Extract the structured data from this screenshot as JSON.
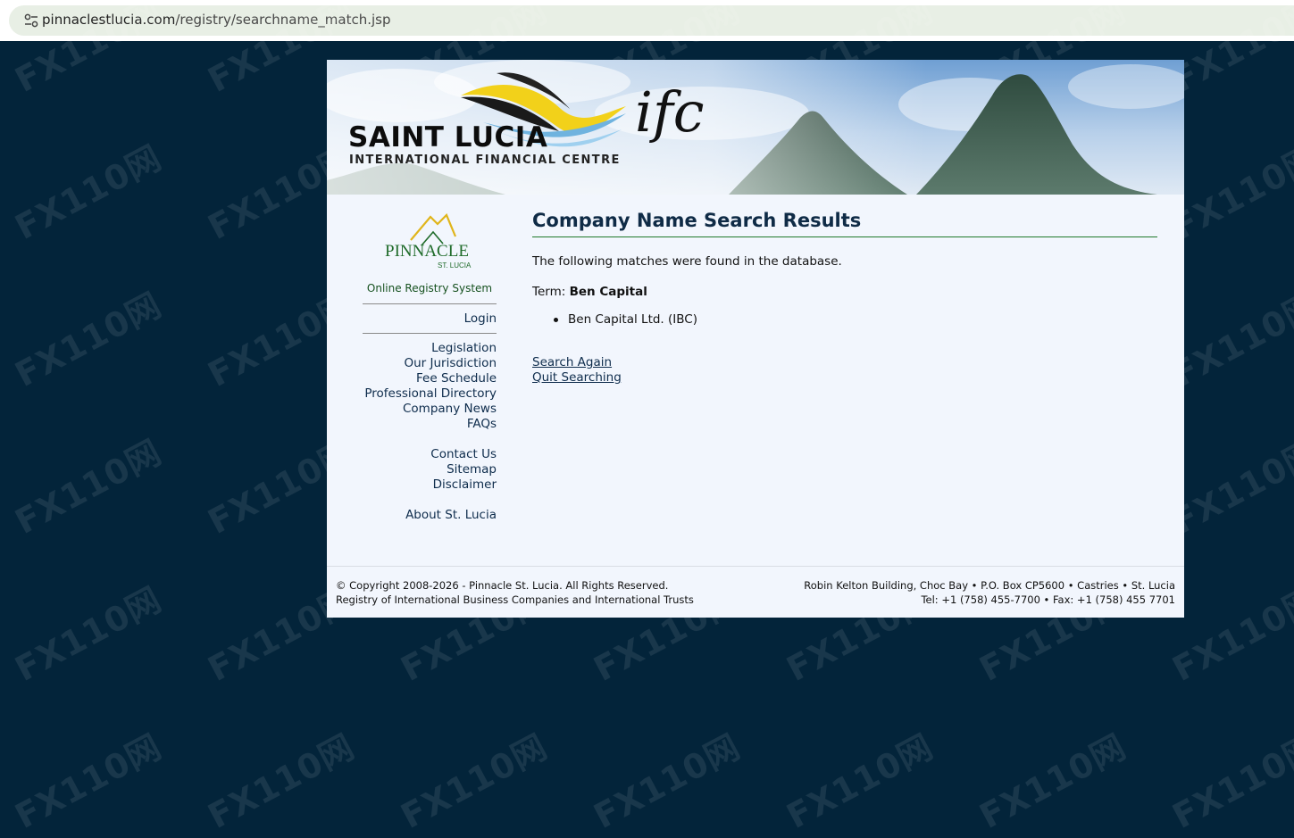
{
  "browser": {
    "url_host": "pinnaclestlucia.com",
    "url_path": "/registry/searchname_match.jsp",
    "site_icon": "tune-icon"
  },
  "banner": {
    "title_line1": "SAINT LUCIA",
    "title_line2": "INTERNATIONAL FINANCIAL CENTRE",
    "ifc_mark": "ifc"
  },
  "sidebar": {
    "logo_text": "PINNACLE",
    "logo_subtext": "ST. LUCIA",
    "system_label": "Online Registry System",
    "login": "Login",
    "nav_primary": [
      "Legislation",
      "Our Jurisdiction",
      "Fee Schedule",
      "Professional Directory",
      "Company News",
      "FAQs"
    ],
    "nav_secondary": [
      "Contact Us",
      "Sitemap",
      "Disclaimer"
    ],
    "nav_tertiary": [
      "About St. Lucia"
    ]
  },
  "main": {
    "title": "Company Name Search Results",
    "intro": "The following matches were found in the database.",
    "term_label": "Term:",
    "term_value": "Ben Capital",
    "results": [
      "Ben Capital Ltd. (IBC)"
    ],
    "search_again": "Search Again",
    "quit_searching": "Quit Searching"
  },
  "footer": {
    "copyright": "© Copyright 2008-2026 - Pinnacle St. Lucia. All Rights Reserved.",
    "registry": "Registry of International Business Companies and International Trusts",
    "address": "Robin Kelton Building, Choc Bay • P.O. Box CP5600 • Castries • St. Lucia",
    "contact": "Tel: +1 (758) 455-7700 • Fax: +1 (758) 455 7701"
  },
  "watermark_text": "FX110网",
  "colors": {
    "background": "#03243a",
    "page": "#f2f6fd",
    "title": "#0f2b46",
    "title_rule": "#1f7a2a",
    "link": "#0e2c4c",
    "registry_label": "#16511f"
  }
}
